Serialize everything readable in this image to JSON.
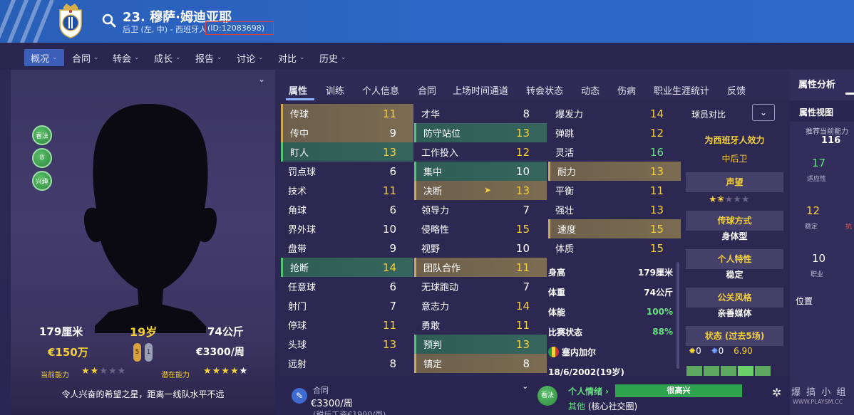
{
  "header": {
    "player_name": "23. 穆萨·姆迪亚耶",
    "player_sub": "后卫 (左, 中) - 西班牙人",
    "player_id": "(ID:12083698)"
  },
  "nav": [
    {
      "label": "概况",
      "active": true
    },
    {
      "label": "合同"
    },
    {
      "label": "转会"
    },
    {
      "label": "成长"
    },
    {
      "label": "报告"
    },
    {
      "label": "讨论"
    },
    {
      "label": "对比"
    },
    {
      "label": "历史"
    }
  ],
  "profile": {
    "badges": [
      "看法",
      "B",
      "兴趣"
    ],
    "height": "179厘米",
    "age": "19岁",
    "weight": "74公斤",
    "value": "€150万",
    "wage": "€3300/周",
    "foot_left": "5",
    "foot_right": "1",
    "current_ability_label": "当前能力",
    "potential_ability_label": "潜在能力",
    "ca_stars": 2,
    "pa_stars": 4.5,
    "scout_quote": "令人兴奋的希望之星，距离一线队水平不远"
  },
  "tabs": [
    "属性",
    "训练",
    "个人信息",
    "合同",
    "上场时间通道",
    "转会状态",
    "动态",
    "伤病",
    "职业生涯统计",
    "反馈"
  ],
  "attributes": {
    "technical": [
      {
        "name": "传球",
        "value": "11",
        "color": "yellow",
        "hl": "gold"
      },
      {
        "name": "传中",
        "value": "9",
        "color": "white",
        "hl": "gold"
      },
      {
        "name": "盯人",
        "value": "13",
        "color": "yellow",
        "hl": "green"
      },
      {
        "name": "罚点球",
        "value": "6",
        "color": "white",
        "hl": ""
      },
      {
        "name": "技术",
        "value": "11",
        "color": "yellow",
        "hl": ""
      },
      {
        "name": "角球",
        "value": "6",
        "color": "white",
        "hl": ""
      },
      {
        "name": "界外球",
        "value": "10",
        "color": "white",
        "hl": ""
      },
      {
        "name": "盘带",
        "value": "9",
        "color": "white",
        "hl": ""
      },
      {
        "name": "抢断",
        "value": "14",
        "color": "yellow",
        "hl": "green"
      },
      {
        "name": "任意球",
        "value": "6",
        "color": "white",
        "hl": ""
      },
      {
        "name": "射门",
        "value": "7",
        "color": "white",
        "hl": ""
      },
      {
        "name": "停球",
        "value": "11",
        "color": "yellow",
        "hl": ""
      },
      {
        "name": "头球",
        "value": "13",
        "color": "yellow",
        "hl": ""
      },
      {
        "name": "远射",
        "value": "8",
        "color": "white",
        "hl": ""
      }
    ],
    "mental": [
      {
        "name": "才华",
        "value": "8",
        "color": "white",
        "hl": ""
      },
      {
        "name": "防守站位",
        "value": "13",
        "color": "yellow",
        "hl": "green"
      },
      {
        "name": "工作投入",
        "value": "12",
        "color": "yellow",
        "hl": ""
      },
      {
        "name": "集中",
        "value": "10",
        "color": "white",
        "hl": "green"
      },
      {
        "name": "决断",
        "value": "13",
        "color": "yellow",
        "hl": "gold",
        "flag": true
      },
      {
        "name": "领导力",
        "value": "7",
        "color": "white",
        "hl": ""
      },
      {
        "name": "侵略性",
        "value": "15",
        "color": "yellow",
        "hl": ""
      },
      {
        "name": "视野",
        "value": "10",
        "color": "white",
        "hl": ""
      },
      {
        "name": "团队合作",
        "value": "11",
        "color": "yellow",
        "hl": "gold"
      },
      {
        "name": "无球跑动",
        "value": "7",
        "color": "white",
        "hl": ""
      },
      {
        "name": "意志力",
        "value": "14",
        "color": "yellow",
        "hl": ""
      },
      {
        "name": "勇敢",
        "value": "11",
        "color": "yellow",
        "hl": ""
      },
      {
        "name": "预判",
        "value": "13",
        "color": "yellow",
        "hl": "green"
      },
      {
        "name": "镇定",
        "value": "8",
        "color": "white",
        "hl": "gold"
      }
    ],
    "physical": [
      {
        "name": "爆发力",
        "value": "14",
        "color": "yellow",
        "hl": ""
      },
      {
        "name": "弹跳",
        "value": "12",
        "color": "yellow",
        "hl": ""
      },
      {
        "name": "灵活",
        "value": "16",
        "color": "green",
        "hl": ""
      },
      {
        "name": "耐力",
        "value": "13",
        "color": "yellow",
        "hl": "gold"
      },
      {
        "name": "平衡",
        "value": "11",
        "color": "yellow",
        "hl": ""
      },
      {
        "name": "强壮",
        "value": "13",
        "color": "yellow",
        "hl": ""
      },
      {
        "name": "速度",
        "value": "15",
        "color": "yellow",
        "hl": "gold"
      },
      {
        "name": "体质",
        "value": "15",
        "color": "yellow",
        "hl": ""
      }
    ]
  },
  "physinfo": [
    {
      "label": "身高",
      "value": "179厘米"
    },
    {
      "label": "体重",
      "value": "74公斤"
    },
    {
      "label": "体能",
      "value": "100%"
    },
    {
      "label": "比赛状态",
      "value": "88%"
    },
    {
      "label": "塞内加尔",
      "value": ""
    },
    {
      "label": "18/6/2002(19岁)",
      "value": ""
    }
  ],
  "compare": {
    "label": "球员对比",
    "plays_for": "为西班牙人效力",
    "position": "中后卫",
    "reputation_label": "声望",
    "pass_label": "传球方式",
    "pass_value": "身体型",
    "personality_label": "个人特性",
    "personality_value": "稳定",
    "media_label": "公关风格",
    "media_value": "亲善媒体",
    "form_label": "状态 (过去5场)",
    "goals": "0",
    "assists": "0",
    "rating": "6.90"
  },
  "bottom": {
    "contract_label": "合同",
    "contract_value": "€3300/周",
    "contract_extra": "(税后工资€1900/周)",
    "mood_badge": "看法",
    "mood_label": "个人情绪 ›",
    "mood_value": "很高兴",
    "mood_sub_a": "其他",
    "mood_sub_b": " (核心社交圈)"
  },
  "right": {
    "title": "属性分析",
    "view": "属性视图",
    "recommend_label": "推荐当前能力",
    "recommend_value": "116",
    "v1": "17",
    "v1_label": "适应性",
    "v2": "12",
    "v2_label": "稳定",
    "v2b_label": "抗",
    "v3": "10",
    "v3_label": "职业",
    "position_label": "位置"
  },
  "watermark": "爆 搞 小 组",
  "watermark_sub": "WWW.PLAYSM.CC",
  "colors": {
    "accent": "#3c5db8",
    "yellow": "#f4d13a",
    "green": "#64e07e"
  }
}
